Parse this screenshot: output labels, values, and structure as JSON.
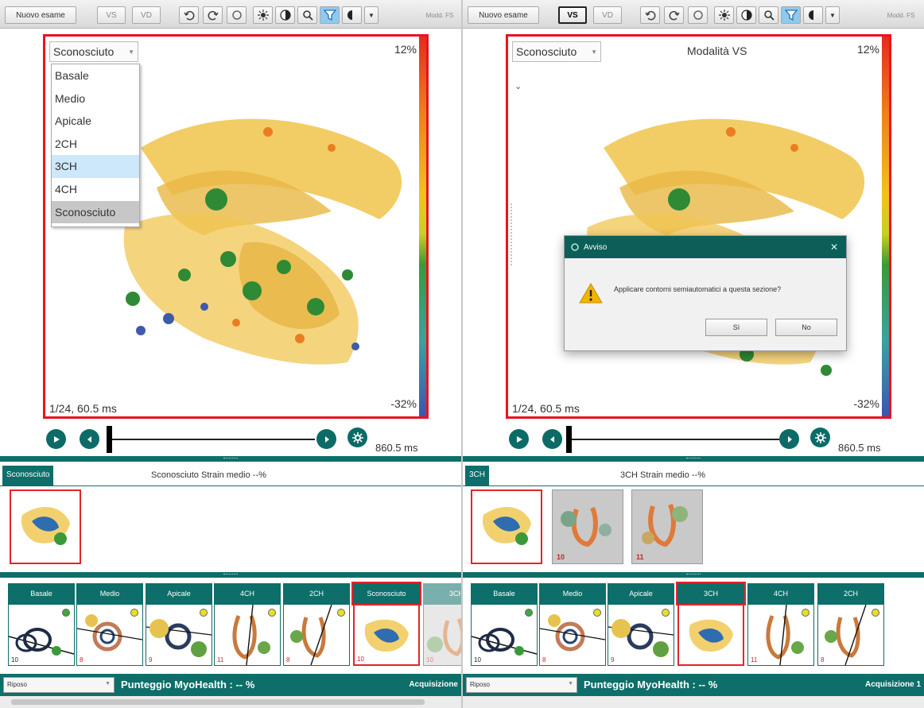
{
  "colors": {
    "accent": "#0d6e6a",
    "selection_border": "#e8141e",
    "dialog_title": "#0c5e59"
  },
  "left": {
    "toolbar": {
      "new_exam": "Nuovo esame",
      "vs": "VS",
      "vd": "VD",
      "mode_fs": "Modd. FS"
    },
    "viewer": {
      "section_value": "Sconosciuto",
      "scale_max": "12%",
      "scale_min": "-32%",
      "frame_info": "1/24, 60.5 ms",
      "dropdown_options": [
        "Basale",
        "Medio",
        "Apicale",
        "2CH",
        "3CH",
        "4CH",
        "Sconosciuto"
      ],
      "dropdown_highlighted": "3CH"
    },
    "playback": {
      "end_time": "860.5 ms"
    },
    "strain": {
      "tag": "Sconosciuto",
      "label": "Sconosciuto Strain medio  --%"
    },
    "series": [
      {
        "label": "Basale",
        "number": "10",
        "red": false,
        "dot": "#3daa3a"
      },
      {
        "label": "Medio",
        "number": "8",
        "red": true,
        "dot": "#e8de2a"
      },
      {
        "label": "Apicale",
        "number": "9",
        "red": true,
        "dot": "#e8de2a"
      },
      {
        "label": "4CH",
        "number": "11",
        "red": true,
        "dot": "#e8de2a"
      },
      {
        "label": "2CH",
        "number": "8",
        "red": true,
        "dot": "#e8de2a"
      },
      {
        "label": "Sconosciuto",
        "number": "10",
        "red": true,
        "dot": ""
      },
      {
        "label": "3CH",
        "number": "10",
        "red": true,
        "dot": ""
      }
    ],
    "footer": {
      "state": "Riposo",
      "score": "Punteggio MyoHealth :  -- %",
      "acquisition": "Acquisizione"
    }
  },
  "right": {
    "toolbar": {
      "new_exam": "Nuovo esame",
      "vs": "VS",
      "vd": "VD",
      "mode_fs": "Modd. FS"
    },
    "viewer": {
      "section_value": "Sconosciuto",
      "mode_label": "Modalità VS",
      "scale_max": "12%",
      "scale_min": "-32%",
      "frame_info": "1/24, 60.5 ms"
    },
    "dialog": {
      "title": "Avviso",
      "message": "Applicare contorni semiautomatici a questa sezione?",
      "yes": "Sì",
      "no": "No"
    },
    "playback": {
      "end_time": "860.5 ms"
    },
    "strain": {
      "tag": "3CH",
      "label": "3CH Strain medio  --%"
    },
    "thumbs": [
      {
        "number": ""
      },
      {
        "number": "10"
      },
      {
        "number": "11"
      }
    ],
    "series": [
      {
        "label": "Basale",
        "number": "10",
        "red": false,
        "dot": "#3daa3a"
      },
      {
        "label": "Medio",
        "number": "8",
        "red": true,
        "dot": "#e8de2a"
      },
      {
        "label": "Apicale",
        "number": "9",
        "red": true,
        "dot": "#e8de2a"
      },
      {
        "label": "3CH",
        "number": "",
        "red": true,
        "dot": ""
      },
      {
        "label": "4CH",
        "number": "11",
        "red": true,
        "dot": "#e8de2a"
      },
      {
        "label": "2CH",
        "number": "8",
        "red": true,
        "dot": "#e8de2a"
      }
    ],
    "footer": {
      "state": "Riposo",
      "score": "Punteggio MyoHealth :  -- %",
      "acquisition": "Acquisizione 1"
    }
  }
}
